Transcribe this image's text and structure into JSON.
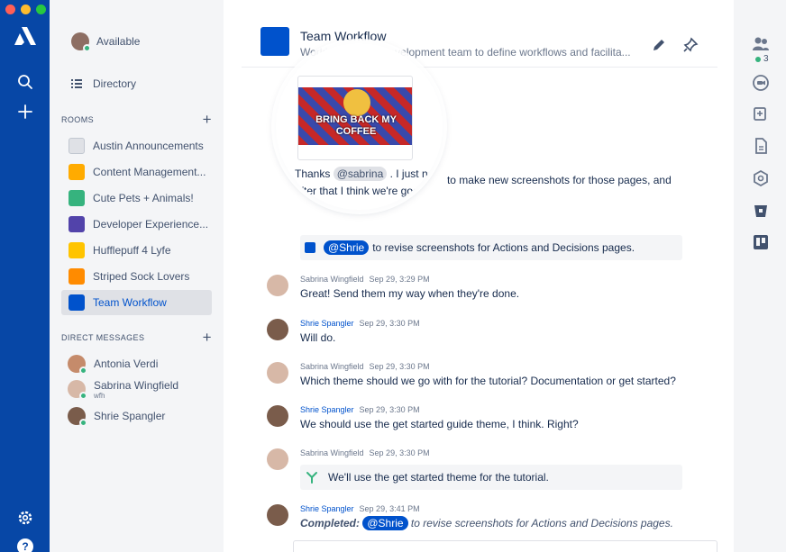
{
  "nav": {
    "search_icon": "search-icon",
    "add_icon": "plus-icon",
    "settings_icon": "gear-icon",
    "help_icon": "question-icon"
  },
  "user": {
    "status": "Available"
  },
  "sidebar": {
    "directory": "Directory",
    "rooms_heading": "ROOMS",
    "rooms": [
      {
        "label": "Austin Announcements",
        "color": "#6b778c",
        "icon_text": ""
      },
      {
        "label": "Content Management...",
        "color": "#ffab00",
        "icon_text": ""
      },
      {
        "label": "Cute Pets + Animals!",
        "color": "#36b37e",
        "icon_text": ""
      },
      {
        "label": "Developer Experience...",
        "color": "#5243aa",
        "icon_text": ""
      },
      {
        "label": "Hufflepuff 4 Lyfe",
        "color": "#ffc400",
        "icon_text": ""
      },
      {
        "label": "Striped Sock Lovers",
        "color": "#ff8b00",
        "icon_text": ""
      },
      {
        "label": "Team Workflow",
        "color": "#0052cc",
        "icon_text": ""
      }
    ],
    "dm_heading": "DIRECT MESSAGES",
    "dms": [
      {
        "name": "Antonia Verdi",
        "sub": ""
      },
      {
        "name": "Sabrina Wingfield",
        "sub": "wfh"
      },
      {
        "name": "Shrie Spangler",
        "sub": ""
      }
    ]
  },
  "room": {
    "title": "Team Workflow",
    "topic": "Working with the development team to define workflows and facilita..."
  },
  "gif": {
    "caption_line1": "BRING BACK MY",
    "caption_line2": "COFFEE"
  },
  "first_message": {
    "thanks": "Thanks",
    "mention": "@sabrina",
    "rest_line1": ". I just need to make new screenshots for those pages, and",
    "line2": "after that I think we're good to go."
  },
  "task": {
    "mention": "@Shrie",
    "text": "to revise screenshots for Actions and Decisions pages."
  },
  "messages": [
    {
      "author": "Sabrina Wingfield",
      "time": "Sep 29, 3:29 PM",
      "text": "Great! Send them my way when they're done."
    },
    {
      "author": "Shrie Spangler",
      "time": "Sep 29, 3:30 PM",
      "text": "Will do."
    },
    {
      "author": "Sabrina Wingfield",
      "time": "Sep 29, 3:30 PM",
      "text": "Which theme should we go with for the tutorial? Documentation or get started?"
    },
    {
      "author": "Shrie Spangler",
      "time": "Sep 29, 3:30 PM",
      "text": "We should use the get started guide theme, I think. Right?"
    },
    {
      "author": "Sabrina Wingfield",
      "time": "Sep 29, 3:30 PM",
      "text": ""
    },
    {
      "author": "Shrie Spangler",
      "time": "Sep 29, 3:41 PM",
      "text": ""
    }
  ],
  "decision": {
    "text": "We'll use the get started theme for the tutorial."
  },
  "completed": {
    "label": "Completed:",
    "mention": "@Shrie",
    "text": "to revise screenshots for Actions and Decisions pages."
  },
  "rail": {
    "participants_count": "3"
  },
  "colors": {
    "nav": "#0747a6",
    "accent": "#0052cc",
    "presence": "#36b37e"
  }
}
